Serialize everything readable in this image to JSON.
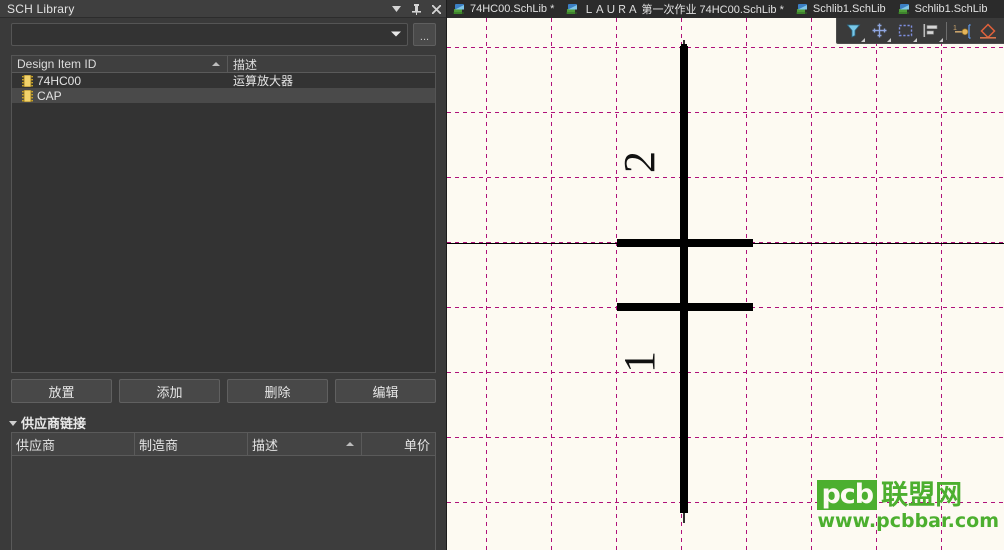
{
  "panel": {
    "title": "SCH Library",
    "titlebar_buttons": [
      {
        "name": "panel-dropdown-icon",
        "glyph": "chevron-down-icon"
      },
      {
        "name": "panel-pin-icon",
        "glyph": "pin-icon"
      },
      {
        "name": "panel-close-icon",
        "glyph": "close-icon"
      }
    ],
    "library_combo": {
      "value": "",
      "placeholder": ""
    },
    "ellipsis_button_label": "...",
    "grid": {
      "columns": [
        {
          "label": "Design Item ID",
          "sort": "ascending"
        },
        {
          "label": "描述",
          "sort": "none"
        }
      ],
      "rows": [
        {
          "icon": "ic-chip-icon",
          "id": "74HC00",
          "description": "运算放大器",
          "selected": false
        },
        {
          "icon": "ic-chip-icon",
          "id": "CAP",
          "description": "",
          "selected": true
        }
      ]
    },
    "buttons": [
      {
        "label": "放置"
      },
      {
        "label": "添加"
      },
      {
        "label": "删除"
      },
      {
        "label": "编辑"
      }
    ],
    "supplier_section": {
      "title": "供应商链接",
      "expanded": true,
      "columns": [
        {
          "label": "供应商",
          "sort": "none"
        },
        {
          "label": "制造商",
          "sort": "none"
        },
        {
          "label": "描述",
          "sort": "ascending"
        },
        {
          "label": "单价",
          "sort": "none"
        }
      ],
      "rows": []
    }
  },
  "editor": {
    "tabs": [
      {
        "label": "74HC00.SchLib *",
        "icon": "schlib-icon",
        "active": false
      },
      {
        "label": "ＬＡＵＲＡ 第一次作业 74HC00.SchLib *",
        "icon": "schlib-icon",
        "active": false
      },
      {
        "label": "Schlib1.SchLib",
        "icon": "schlib-icon",
        "active": false
      },
      {
        "label": "Schlib1.SchLib",
        "icon": "schlib-icon",
        "active": true
      }
    ],
    "toolbar": [
      {
        "name": "filter-icon",
        "has_caret": true
      },
      {
        "name": "crosshair-select-icon",
        "has_caret": true
      },
      {
        "name": "marquee-select-icon",
        "has_caret": true
      },
      {
        "name": "align-left-icon",
        "has_caret": true
      },
      {
        "name": "pin-placement-icon",
        "has_caret": false
      },
      {
        "name": "polygon-icon",
        "has_caret": false
      }
    ],
    "canvas": {
      "background_color": "#fdfaf2",
      "grid_color": "#b0117a",
      "symbol_color": "#000000",
      "symbol": {
        "name": "capacitor",
        "pin_labels": [
          "2",
          "1"
        ]
      }
    }
  },
  "watermark": {
    "logo_text": "pcb",
    "brand_cn": "联盟网",
    "url": "www.pcbbar.com",
    "color": "#4caf2f"
  }
}
